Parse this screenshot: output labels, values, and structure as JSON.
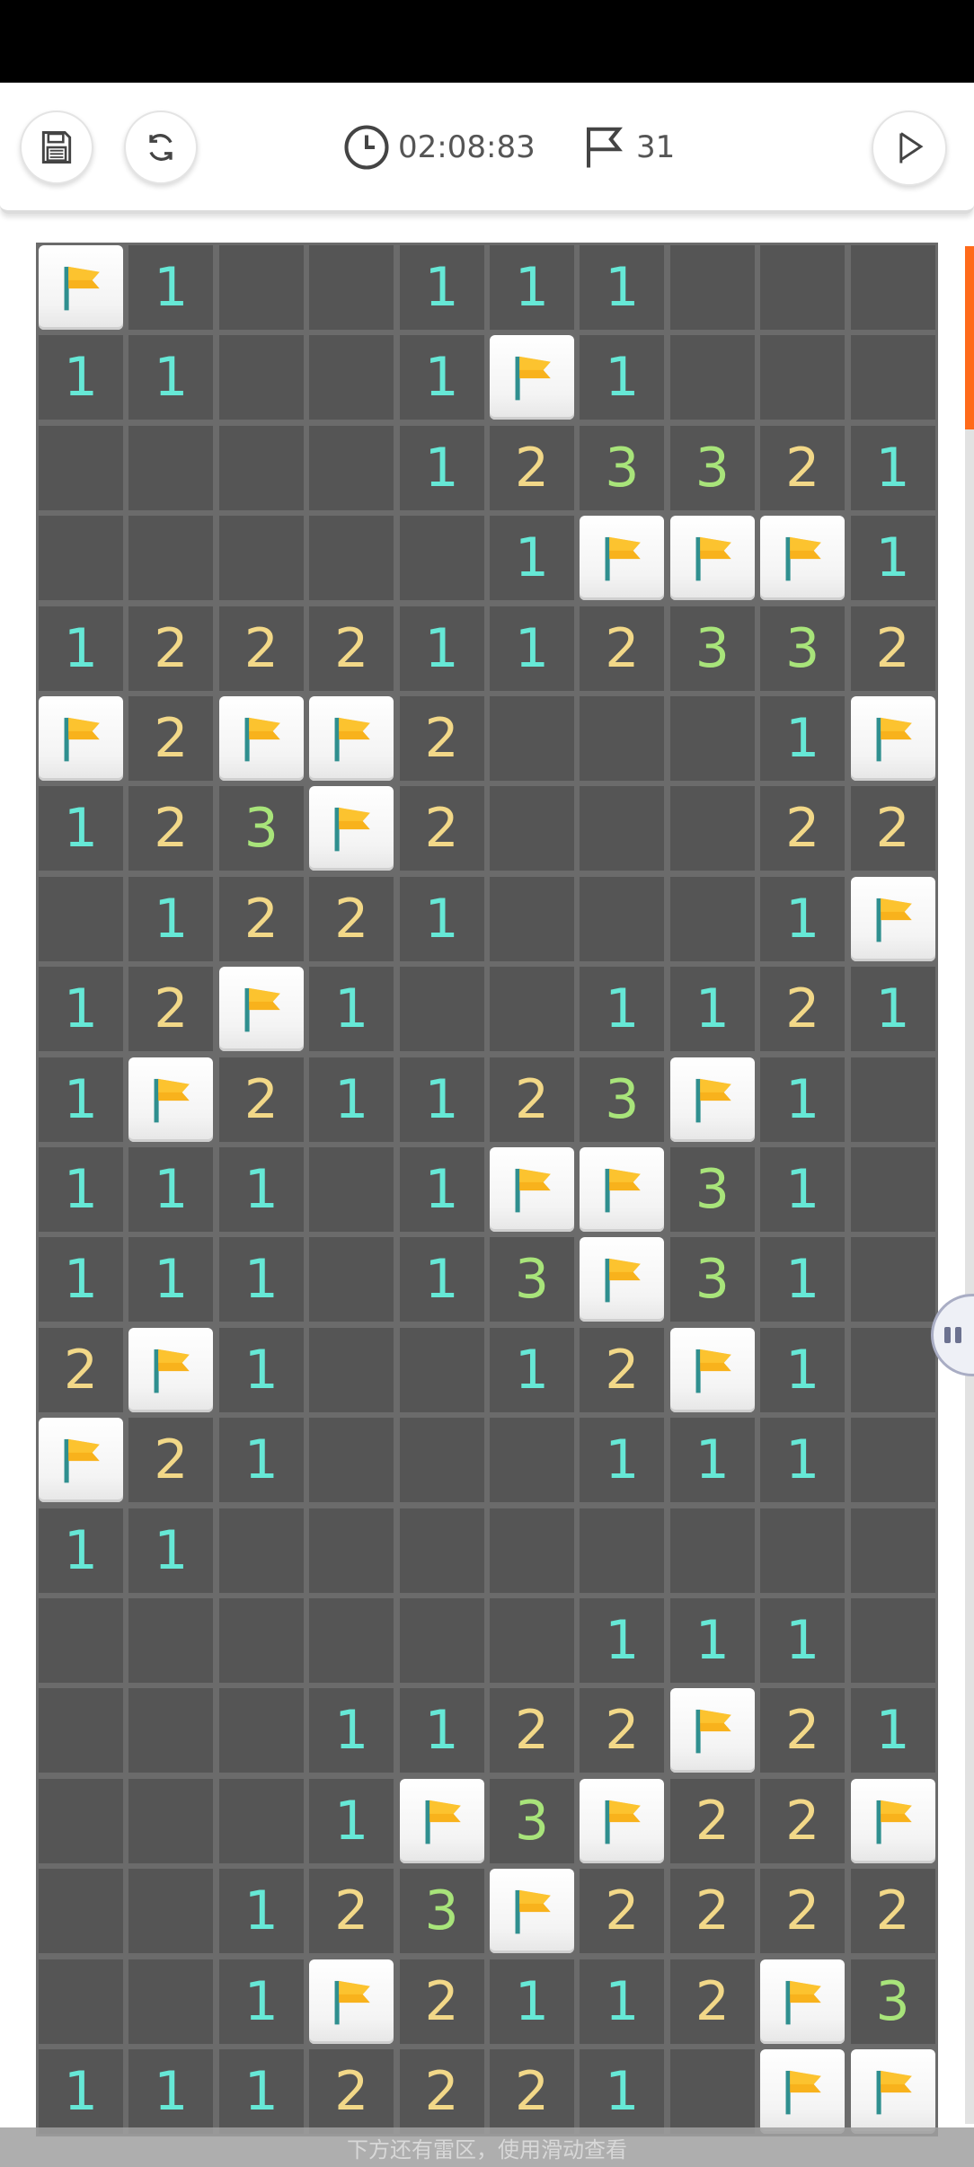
{
  "toolbar": {
    "save_icon": "floppy-disk-icon",
    "restart_icon": "refresh-icon",
    "timer_icon": "clock-icon",
    "timer": "02:08:83",
    "flag_icon": "flag-outline-icon",
    "flags_count": "31",
    "play_icon": "play-icon"
  },
  "board": {
    "cols": 10,
    "rows": [
      "F1--111---",
      "11--1F1---",
      "----123321",
      "-----1FFF1",
      "1222112332",
      "F2FF2---1F",
      "123F2---22",
      "-1221---1F",
      "12F1--1121",
      "1F21123F1-",
      "111-1FF31-",
      "111-13F31-",
      "2F1--12F1-",
      "F21---111-",
      "11--------",
      "------111-",
      "---1122F21",
      "---1F3F22F",
      "--123F2222",
      "--1F2112F3",
      "1112221-FF"
    ],
    "legend": {
      "F": "flag",
      "-": "empty",
      "1": "number",
      "2": "number",
      "3": "number"
    },
    "colors": {
      "1": "#66e8d6",
      "2": "#f2d888",
      "3": "#a8e47a",
      "cell": "#555555",
      "grid": "#6b6b6b",
      "flag": "#f8b21c"
    }
  },
  "scroll": {
    "accent": "#ff6a1a",
    "position_fraction": 0.0
  },
  "hint": {
    "text": "下方还有雷区，使用滑动查看"
  }
}
